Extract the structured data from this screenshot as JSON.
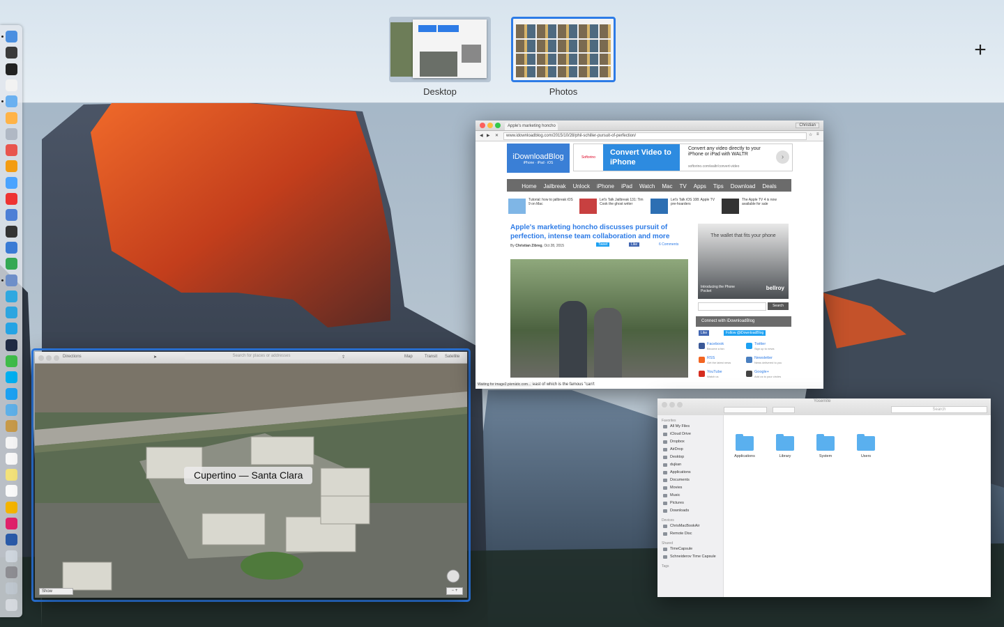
{
  "spaces": [
    {
      "label": "Desktop",
      "selected": false
    },
    {
      "label": "Photos",
      "selected": true
    }
  ],
  "add_space_symbol": "+",
  "dock_icons": [
    "finder-icon",
    "mission-control-icon",
    "terminal-icon",
    "textedit-icon",
    "preview-icon",
    "photos-icon",
    "launchpad-icon",
    "itunes-icon",
    "ibooks-icon",
    "app-store-icon",
    "music-icon",
    "xcode-icon",
    "screenshot-icon",
    "safari-icon",
    "chrome-icon",
    "utility-icon",
    "messages-icon",
    "telegram-icon",
    "chat-icon",
    "slack-icon",
    "app-icon",
    "skype-icon",
    "twitter-icon",
    "tweetbot-icon",
    "notes-icon",
    "calendar-icon",
    "reminders-icon",
    "sticky-icon",
    "calendar-17-icon",
    "photo-icon",
    "lips-icon",
    "1password-icon",
    "screen-icon",
    "system-preferences-icon",
    "downloads-icon",
    "trash-icon"
  ],
  "maps": {
    "toolbar": {
      "directions": "Directions",
      "search_placeholder": "Search for places or addresses",
      "map": "Map",
      "transit": "Transit",
      "satellite": "Satellite"
    },
    "location_label": "Cupertino — Santa Clara",
    "show_button": "Show"
  },
  "browser": {
    "tab_title": "Apple's marketing honcho",
    "user": "Christian",
    "url": "www.idownloadblog.com/2015/10/28/phil-schiller-pursuit-of-perfection/",
    "logo": "iDownloadBlog",
    "logo_sub": "iPhone · iPad · iOS",
    "ad_brand": "Softorino",
    "ad_headline": "Convert Video to iPhone",
    "ad_text": "Convert any video directly to your iPhone or iPad with WALTR",
    "ad_url": "softorino.com/waltr/convert-video",
    "nav": [
      "Home",
      "Jailbreak",
      "Unlock",
      "iPhone",
      "iPad",
      "Watch",
      "Mac",
      "TV",
      "Apps",
      "Tips",
      "Download",
      "Deals"
    ],
    "teasers": [
      "Tutorial: how to jailbreak iOS 9 on Mac",
      "Let's Talk Jailbreak 131: Tim Cook the ghost writer",
      "Let's Talk iOS 108: Apple TV pre-hoarders",
      "The Apple TV 4 is now available for sale"
    ],
    "headline": "Apple's marketing honcho discusses pursuit of perfection, intense team collaboration and more",
    "byline_prefix": "By",
    "byline_author": "Christian Zibreg",
    "byline_date": "Oct 28, 2015",
    "tweet": "Tweet",
    "like": "Like",
    "comments": "6 Comments",
    "side_ad_text": "The wallet that fits your phone",
    "side_ad_sub": "Introducing the Phone Pocket",
    "side_ad_brand": "bellroy",
    "search_button": "Search",
    "connect_header": "Connect with iDownloadBlog",
    "follow": "Follow @iDownloadBlog",
    "social": [
      {
        "name": "Facebook",
        "sub": "Become a fan",
        "color": "#3b5998"
      },
      {
        "name": "Twitter",
        "sub": "Sign up to news",
        "color": "#1da1f2"
      },
      {
        "name": "RSS",
        "sub": "Get the latest news",
        "color": "#f26522"
      },
      {
        "name": "Newsletter",
        "sub": "News delivered to you",
        "color": "#4a7fc0"
      },
      {
        "name": "YouTube",
        "sub": "Watch us",
        "color": "#d62d20"
      },
      {
        "name": "Google+",
        "sub": "Add us to your circles",
        "color": "#444"
      }
    ],
    "article_snippet": "tatives, not least of which is the famous \"can't",
    "status": "Waiting for image2.pixmatic.com..."
  },
  "finder": {
    "title": "Yosemite",
    "search_placeholder": "Search",
    "favorites_head": "Favorites",
    "favorites": [
      "All My Files",
      "iCloud Drive",
      "Dropbox",
      "AirDrop",
      "Desktop",
      "dujkan",
      "Applications",
      "Documents",
      "Movies",
      "Music",
      "Pictures",
      "Downloads"
    ],
    "devices_head": "Devices",
    "devices": [
      "ChrisMacBookAir",
      "Remote Disc"
    ],
    "shared_head": "Shared",
    "shared": [
      "TimeCapsule",
      "Schneiderov Time Capsule"
    ],
    "tags_head": "Tags",
    "folders": [
      "Applications",
      "Library",
      "System",
      "Users"
    ]
  }
}
